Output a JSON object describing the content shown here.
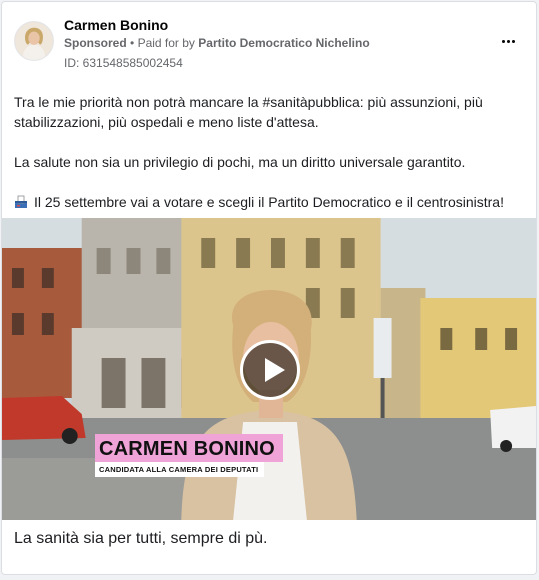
{
  "post": {
    "page_name": "Carmen Bonino",
    "sponsored_label": "Sponsored",
    "separator": "•",
    "paid_for_prefix": "Paid for by",
    "payer": "Partito Democratico Nichelino",
    "ad_id": "ID: 631548585002454",
    "menu_icon": "more-horizontal-icon"
  },
  "body": {
    "paragraph_1": "Tra le mie priorità non potrà mancare la #sanitàpubblica: più assunzioni, più stabilizzazioni, più ospedali e meno liste d'attesa.",
    "paragraph_2": "La salute non sia un privilegio di pochi, ma un diritto universale garantito.",
    "paragraph_3": "Il 25 settembre vai a votare e scegli il Partito Democratico e il centrosinistra!",
    "paragraph_3_icon": "ballot-box-icon"
  },
  "video": {
    "overlay_name": "CARMEN BONINO",
    "overlay_role": "CANDIDATA ALLA CAMERA DEI DEPUTATI",
    "play_icon": "play-icon",
    "accent_color": "#f0a3d6"
  },
  "caption": "La sanità sia per tutti, sempre di pù."
}
